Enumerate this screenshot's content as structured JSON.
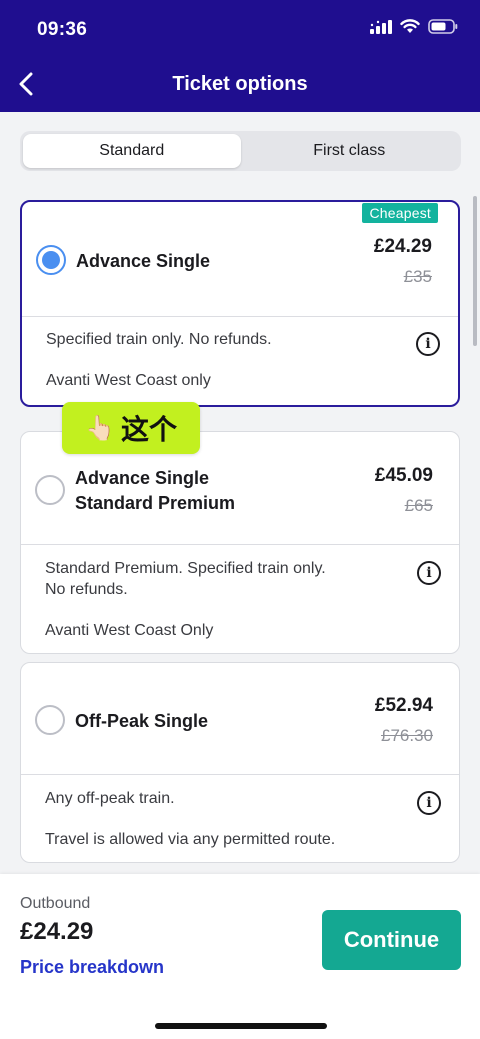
{
  "status_bar": {
    "time": "09:36"
  },
  "nav": {
    "title": "Ticket options"
  },
  "class_tabs": [
    {
      "label": "Standard",
      "active": true
    },
    {
      "label": "First class",
      "active": false
    }
  ],
  "tickets": [
    {
      "name": "Advance Single",
      "badge": "Cheapest",
      "price": "£24.29",
      "original_price": "£35",
      "selected": true,
      "description": "Specified train only. No refunds.",
      "operator": "Avanti West Coast only"
    },
    {
      "name_line1": "Advance Single",
      "name_line2": "Standard Premium",
      "price": "£45.09",
      "original_price": "£65",
      "selected": false,
      "description_line1": "Standard Premium. Specified train only.",
      "description_line2": "No refunds.",
      "operator": "Avanti West Coast Only"
    },
    {
      "name": "Off-Peak Single",
      "price": "£52.94",
      "original_price": "£76.30",
      "selected": false,
      "description": "Any off-peak train.",
      "operator": "Travel is allowed via any permitted route."
    }
  ],
  "sticker": {
    "hand": "👆🏻",
    "text": "这个"
  },
  "footer": {
    "outbound_label": "Outbound",
    "outbound_price": "£24.29",
    "breakdown_label": "Price breakdown",
    "continue_label": "Continue"
  },
  "colors": {
    "header": "#1f0e8f",
    "accent_teal": "#13b39e",
    "selected_radio": "#4a8ff0",
    "link": "#2635c9"
  }
}
